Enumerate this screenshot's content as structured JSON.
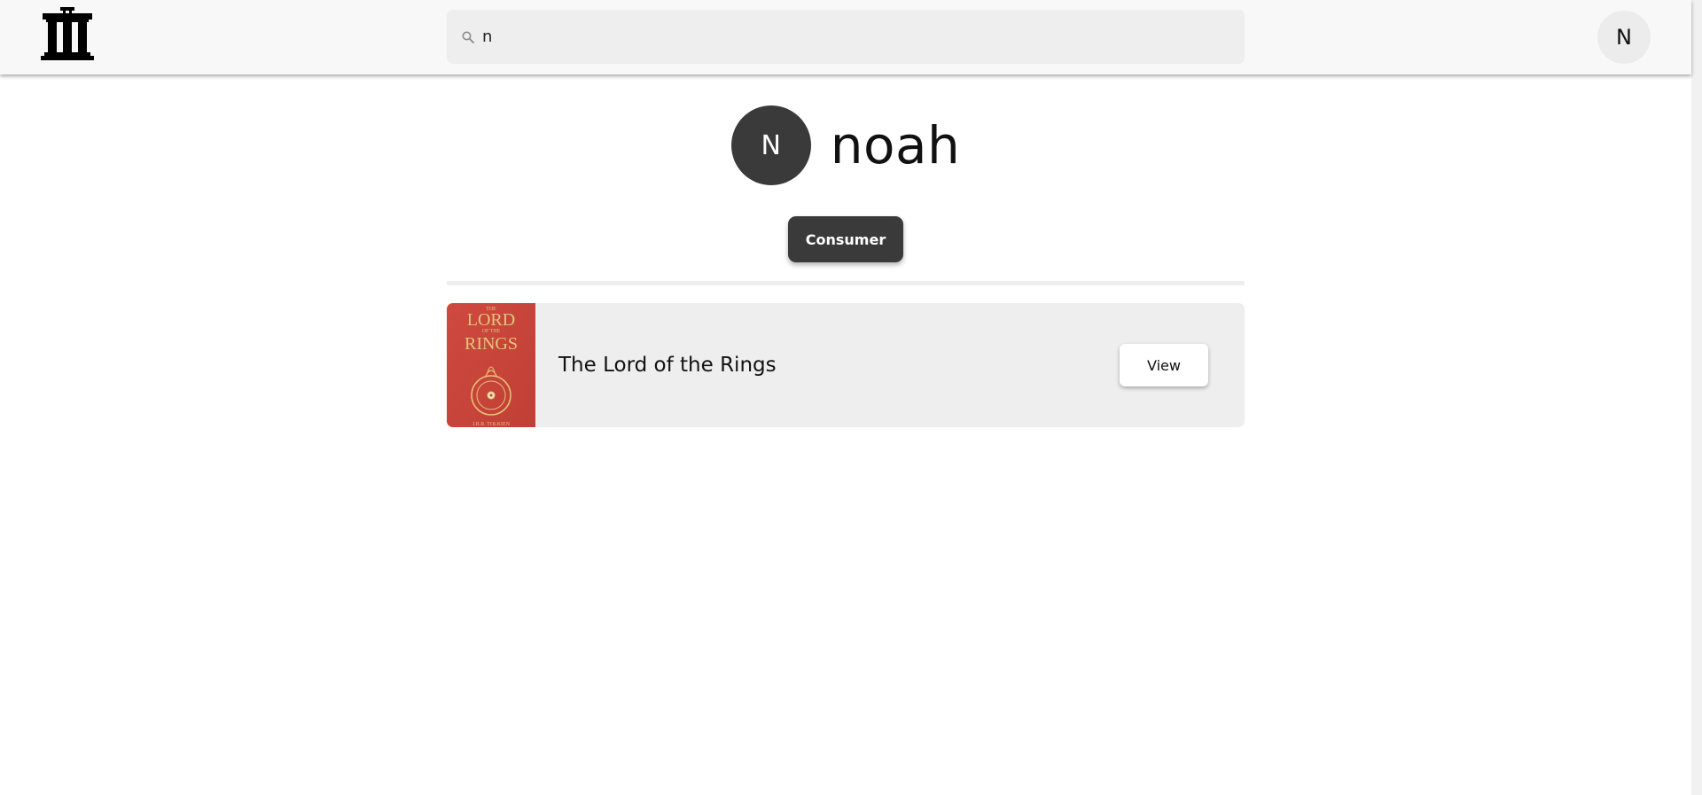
{
  "header": {
    "logo_icon": "bank-columns-icon",
    "search": {
      "icon": "search-icon",
      "value": "n",
      "placeholder": ""
    },
    "user_initial": "N"
  },
  "profile": {
    "avatar_initial": "N",
    "username": "noah",
    "role": "Consumer"
  },
  "books": [
    {
      "title": "The Lord of the Rings",
      "cover_text": {
        "line1": "THE",
        "line2": "LORD",
        "line3": "OF THE",
        "line4": "RINGS",
        "author": "J.R.R. TOLKIEN"
      },
      "action_label": "View"
    }
  ],
  "colors": {
    "topbar_bg": "#f8f8f8",
    "search_bg": "#eeeeee",
    "dark_accent": "#3a3a3a",
    "card_bg": "#eeeeee",
    "cover_red": "#c8443a",
    "cover_gold": "#e8c47a"
  }
}
